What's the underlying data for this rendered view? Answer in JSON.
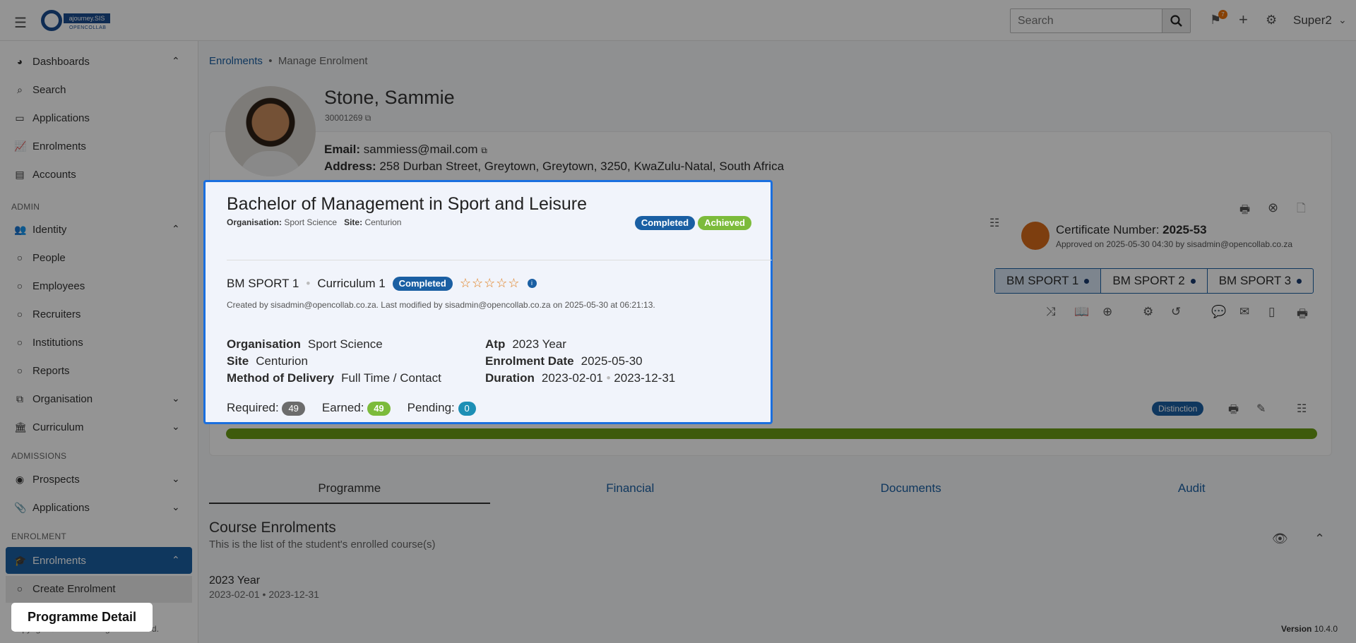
{
  "header": {
    "logo_text": "ajourney.SIS",
    "logo_sub": "OPENCOLLAB",
    "search_placeholder": "Search",
    "notification_count": "7",
    "user_name": "Super2"
  },
  "sidebar": {
    "items": [
      {
        "label": "Dashboards",
        "icon": "dashboard-icon"
      },
      {
        "label": "Search",
        "icon": "search-icon"
      },
      {
        "label": "Applications",
        "icon": "applications-icon"
      },
      {
        "label": "Enrolments",
        "icon": "chart-icon"
      },
      {
        "label": "Accounts",
        "icon": "accounts-icon"
      }
    ],
    "admin_label": "ADMIN",
    "admin_items": [
      {
        "label": "Identity"
      },
      {
        "label": "People"
      },
      {
        "label": "Employees"
      },
      {
        "label": "Recruiters"
      },
      {
        "label": "Institutions"
      },
      {
        "label": "Reports"
      },
      {
        "label": "Organisation"
      },
      {
        "label": "Curriculum"
      }
    ],
    "admissions_label": "ADMISSIONS",
    "admissions_items": [
      {
        "label": "Prospects"
      },
      {
        "label": "Applications"
      }
    ],
    "enrolment_label": "ENROLMENT",
    "enrolment_items": [
      {
        "label": "Enrolments"
      },
      {
        "label": "Create Enrolment"
      }
    ]
  },
  "breadcrumb": {
    "root": "Enrolments",
    "current": "Manage Enrolment"
  },
  "student": {
    "name": "Stone, Sammie",
    "id": "30001269",
    "email_label": "Email:",
    "email": "sammiess@mail.com",
    "address_label": "Address:",
    "address": "258 Durban Street, Greytown, Greytown, 3250, KwaZulu-Natal, South Africa"
  },
  "certificate": {
    "label": "Certificate Number:",
    "number": "2025-53",
    "approved": "Approved on 2025-05-30 04:30 by sisadmin@opencollab.co.za"
  },
  "versions": [
    "BM SPORT 1",
    "BM SPORT 2",
    "BM SPORT 3"
  ],
  "distinction": "Distinction",
  "progress_fraction": 1.0,
  "tabs": [
    "Programme",
    "Financial",
    "Documents",
    "Audit"
  ],
  "course_enrolments": {
    "title": "Course Enrolments",
    "subtitle": "This is the list of the student's enrolled course(s)",
    "year": "2023 Year",
    "start": "2023-02-01",
    "end": "2023-12-31"
  },
  "footer": {
    "copyright": "Copyright © 2025 ... All rights reserved.",
    "version_label": "Version",
    "version": "10.4.0"
  },
  "modal": {
    "title": "Bachelor of Management in Sport and Leisure",
    "org_label": "Organisation:",
    "org": "Sport Science",
    "site_label": "Site:",
    "site": "Centurion",
    "status": "Completed",
    "result": "Achieved",
    "version_code": "BM SPORT 1",
    "curriculum": "Curriculum 1",
    "version_status": "Completed",
    "stars": "☆☆☆☆☆",
    "created": "Created by sisadmin@opencollab.co.za. Last modified by sisadmin@opencollab.co.za on 2025-05-30 at 06:21:13.",
    "details": {
      "organisation_label": "Organisation",
      "organisation": "Sport Science",
      "site_label": "Site",
      "site": "Centurion",
      "delivery_label": "Method of Delivery",
      "delivery": "Full Time / Contact",
      "atp_label": "Atp",
      "atp": "2023 Year",
      "enrol_date_label": "Enrolment Date",
      "enrol_date": "2025-05-30",
      "duration_label": "Duration",
      "duration_start": "2023-02-01",
      "duration_end": "2023-12-31"
    },
    "counts": {
      "required_label": "Required:",
      "required": "49",
      "earned_label": "Earned:",
      "earned": "49",
      "pending_label": "Pending:",
      "pending": "0"
    }
  },
  "tooltip": "Programme Detail"
}
